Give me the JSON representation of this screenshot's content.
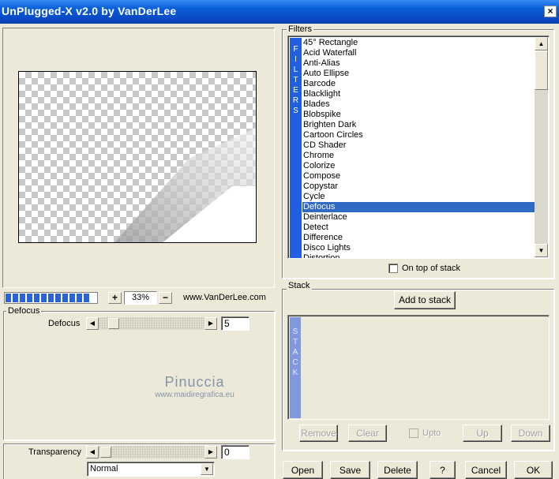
{
  "window": {
    "title": "UnPlugged-X v2.0 by VanDerLee",
    "close_label": "×"
  },
  "preview": {
    "zoom": "33%",
    "zoom_in": "+",
    "zoom_out": "−",
    "website": "www.VanDerLee.com",
    "progress_segments": 12
  },
  "defocus_group": {
    "label": "Defocus",
    "param_label": "Defocus",
    "param_value": "5",
    "watermark_big": "Pinuccia",
    "watermark_small": "www.maidiregrafica.eu"
  },
  "transparency": {
    "label": "Transparency",
    "value": "0",
    "blend_mode": "Normal"
  },
  "filters": {
    "label": "Filters",
    "side_letters": [
      "F",
      "I",
      "L",
      "T",
      "E",
      "R",
      "S"
    ],
    "items": [
      "45° Rectangle",
      "Acid Waterfall",
      "Anti-Alias",
      "Auto Ellipse",
      "Barcode",
      "Blacklight",
      "Blades",
      "Blobspike",
      "Brighten Dark",
      "Cartoon Circles",
      "CD Shader",
      "Chrome",
      "Colorize",
      "Compose",
      "Copystar",
      "Cycle",
      "Defocus",
      "Deinterlace",
      "Detect",
      "Difference",
      "Disco Lights",
      "Distortion"
    ],
    "selected": "Defocus",
    "on_top_label": "On top of stack"
  },
  "stack": {
    "label": "Stack",
    "add_label": "Add to stack",
    "side_letters": [
      "S",
      "T",
      "A",
      "C",
      "K"
    ],
    "remove_label": "Remove",
    "clear_label": "Clear",
    "upto_label": "Upto",
    "up_label": "Up",
    "down_label": "Down"
  },
  "buttons": {
    "open": "Open",
    "save": "Save",
    "delete": "Delete",
    "help": "?",
    "cancel": "Cancel",
    "ok": "OK"
  },
  "colors": {
    "title_bar": "#0a5fd8",
    "list_selection": "#316ac5",
    "filters_strip": "#2060e0",
    "stack_strip": "#7f98e0"
  }
}
